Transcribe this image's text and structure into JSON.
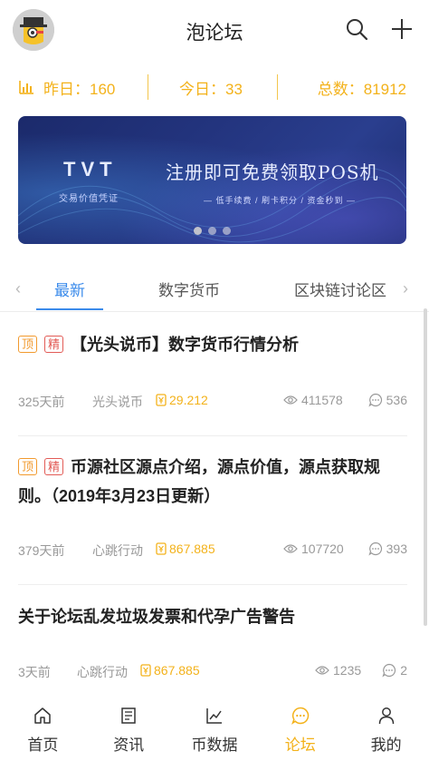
{
  "header": {
    "title": "泡论坛",
    "avatar_icon": "user-avatar-icon",
    "search_icon": "search-icon",
    "add_icon": "plus-icon"
  },
  "stats": {
    "icon": "bar-chart-icon",
    "yesterday": "昨日：160",
    "today": "今日：33",
    "total": "总数：81912",
    "color": "#f3b21b"
  },
  "banner": {
    "logo": "TVT",
    "logo_sub": "交易价值凭证",
    "headline": "注册即可免费领取POS机",
    "subline": "— 低手续费 / 刷卡积分 / 资金秒到 —",
    "slide_count": 3,
    "active_slide": 1
  },
  "tabs": {
    "items": [
      "最新",
      "数字货币",
      "区块链讨论区"
    ],
    "active": 0,
    "accent": "#3b8beb"
  },
  "posts": [
    {
      "tags": [
        "顶",
        "精"
      ],
      "title": "【光头说币】数字货币行情分析",
      "time": "325天前",
      "author": "光头说币",
      "score": "29.212",
      "views": "411578",
      "comments": "536"
    },
    {
      "tags": [
        "顶",
        "精"
      ],
      "title": "币源社区源点介绍，源点价值，源点获取规则。（2019年3月23日更新）",
      "time": "379天前",
      "author": "心跳行动",
      "score": "867.885",
      "views": "107720",
      "comments": "393"
    },
    {
      "tags": [],
      "title": "关于论坛乱发垃圾发票和代孕广告警告",
      "time": "3天前",
      "author": "心跳行动",
      "score": "867.885",
      "views": "1235",
      "comments": "2"
    }
  ],
  "bottom_nav": {
    "items": [
      {
        "label": "首页",
        "icon": "home-icon"
      },
      {
        "label": "资讯",
        "icon": "news-icon"
      },
      {
        "label": "币数据",
        "icon": "chart-line-icon"
      },
      {
        "label": "论坛",
        "icon": "chat-bubble-icon"
      },
      {
        "label": "我的",
        "icon": "person-icon"
      }
    ],
    "active": 3,
    "active_color": "#f3b21b"
  }
}
